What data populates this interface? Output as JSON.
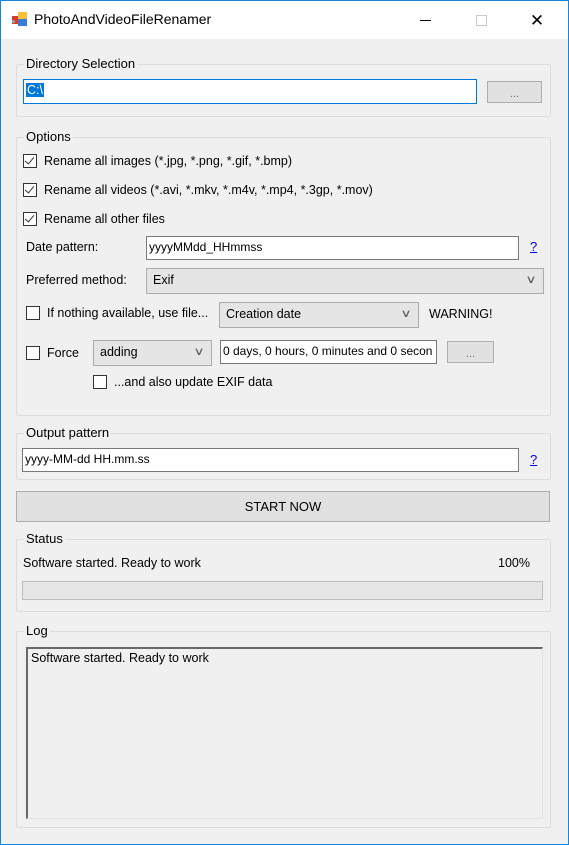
{
  "window": {
    "title": "PhotoAndVideoFileRenamer",
    "controls": {
      "minimize": "minimize",
      "maximize": "maximize",
      "close": "✕"
    }
  },
  "directory": {
    "legend": "Directory Selection",
    "path_value": "C:\\",
    "browse_label": "..."
  },
  "options": {
    "legend": "Options",
    "rename_images": {
      "label": "Rename all images (*.jpg, *.png, *.gif, *.bmp)",
      "checked": true
    },
    "rename_videos": {
      "label": "Rename all videos (*.avi, *.mkv, *.m4v, *.mp4, *.3gp, *.mov)",
      "checked": true
    },
    "rename_other": {
      "label": "Rename all other files",
      "checked": true
    },
    "date_pattern": {
      "label": "Date pattern:",
      "value": "yyyyMMdd_HHmmss",
      "help": "?"
    },
    "preferred_method": {
      "label": "Preferred method:",
      "value": "Exif"
    },
    "fallback": {
      "label": "If nothing available, use file...",
      "checked": false,
      "value": "Creation date",
      "warning": "WARNING!"
    },
    "force": {
      "label": "Force",
      "checked": false,
      "mode": "adding",
      "offset_value": "0 days, 0 hours, 0 minutes and 0 secon",
      "edit_label": "..."
    },
    "update_exif": {
      "label": "...and also update EXIF data",
      "checked": false
    }
  },
  "output": {
    "legend": "Output pattern",
    "value": "yyyy-MM-dd HH.mm.ss",
    "help": "?"
  },
  "start_button": "START NOW",
  "status": {
    "legend": "Status",
    "message": "Software started. Ready to work",
    "percent_label": "100%",
    "progress_percent": 100
  },
  "log": {
    "legend": "Log",
    "text": "Software started. Ready to work"
  }
}
